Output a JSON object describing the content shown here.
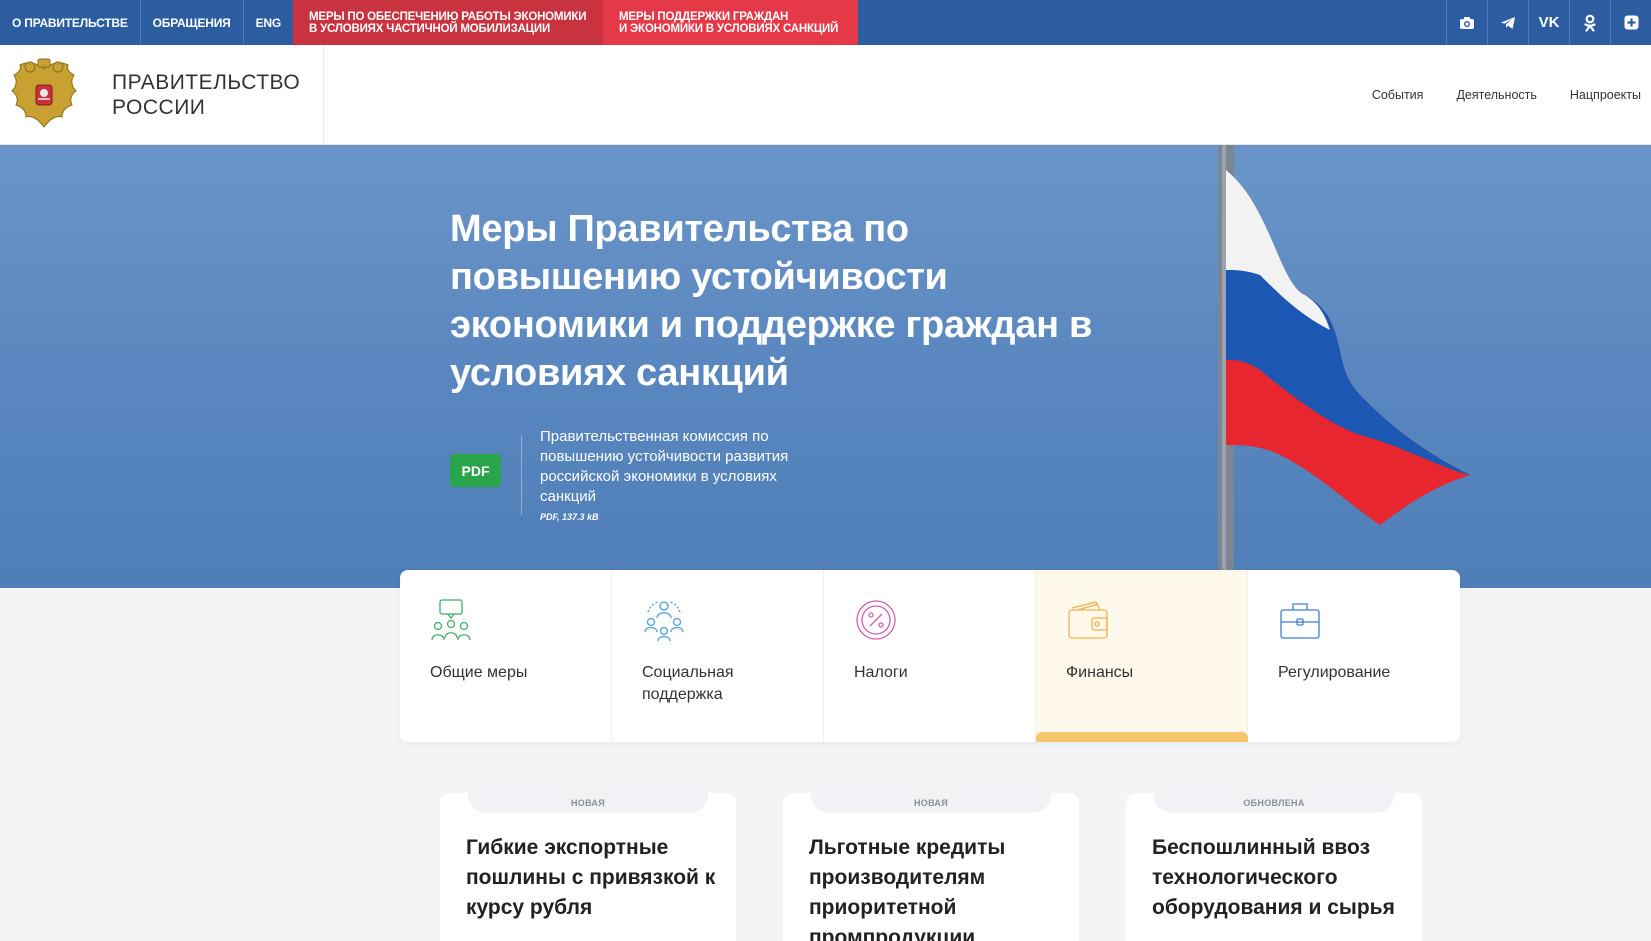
{
  "topbar": {
    "links": [
      "О ПРАВИТЕЛЬСТВЕ",
      "ОБРАЩЕНИЯ",
      "ENG"
    ],
    "promo1": [
      "МЕРЫ ПО ОБЕСПЕЧЕНИЮ РАБОТЫ ЭКОНОМИКИ",
      "В УСЛОВИЯХ ЧАСТИЧНОЙ МОБИЛИЗАЦИИ"
    ],
    "promo2": [
      "МЕРЫ ПОДДЕРЖКИ ГРАЖДАН",
      "И ЭКОНОМИКИ В УСЛОВИЯХ САНКЦИЙ"
    ],
    "icons": [
      "camera-icon",
      "telegram-icon",
      "vk-icon",
      "odnoklassniki-icon",
      "plus-icon"
    ],
    "icon_glyphs": [
      "◙",
      "➤",
      "VK",
      "ОК",
      "+"
    ],
    "colors": {
      "bar": "#2d5da1",
      "promo1": "#c9323f",
      "promo2": "#e53947"
    }
  },
  "header": {
    "title_line1": "ПРАВИТЕЛЬСТВО",
    "title_line2": "РОССИИ",
    "nav": [
      "События",
      "Деятельность",
      "Нацпроекты"
    ]
  },
  "hero": {
    "title": "Меры Правительства по повышению устойчивости экономики и поддержке граждан в условиях санкций",
    "pdf_label": "PDF",
    "pdf_title": "Правительственная комиссия по повышению устойчивости развития российской экономики в условиях санкций",
    "pdf_meta": "PDF, 137.3 kB"
  },
  "categories": [
    {
      "label": "Общие меры",
      "icon": "people-discussion-icon",
      "color": "#3fae6a",
      "active": false
    },
    {
      "label": "Социальная поддержка",
      "icon": "community-icon",
      "color": "#4a9fd8",
      "active": false
    },
    {
      "label": "Налоги",
      "icon": "percent-icon",
      "color": "#d45db3",
      "active": false
    },
    {
      "label": "Финансы",
      "icon": "wallet-icon",
      "color": "#f2b24b",
      "active": true
    },
    {
      "label": "Регулирование",
      "icon": "briefcase-icon",
      "color": "#3d7fd6",
      "active": false
    }
  ],
  "cards": [
    {
      "tag": "НОВАЯ",
      "title": "Гибкие экспортные пошлины с привязкой к курсу рубля"
    },
    {
      "tag": "НОВАЯ",
      "title": "Льготные кредиты производителям приоритетной промпродукции"
    },
    {
      "tag": "ОБНОВЛЕНА",
      "title": "Беспошлинный ввоз технологического оборудования и сырья"
    }
  ]
}
